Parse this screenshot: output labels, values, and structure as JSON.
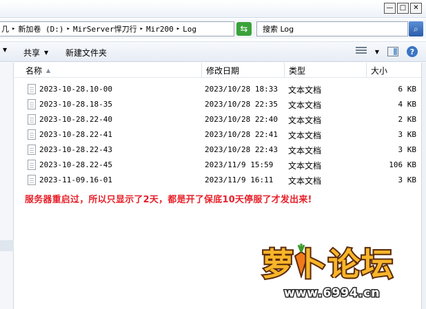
{
  "window": {
    "minimize_glyph": "—",
    "maximize_glyph": "□",
    "close_glyph": "✕"
  },
  "address": {
    "segments": [
      "几",
      "新加卷 (D:)",
      "MirServer悍刀行",
      "Mir200",
      "Log"
    ],
    "separator": "▸"
  },
  "search": {
    "placeholder": "搜索 Log"
  },
  "toolbar": {
    "share_label": "共享",
    "new_folder_label": "新建文件夹"
  },
  "columns": {
    "name": "名称",
    "modified": "修改日期",
    "type": "类型",
    "size": "大小"
  },
  "files": [
    {
      "name": "2023-10-28.10-00",
      "modified": "2023/10/28 18:33",
      "type": "文本文档",
      "size": "6 KB"
    },
    {
      "name": "2023-10-28.18-35",
      "modified": "2023/10/28 22:35",
      "type": "文本文档",
      "size": "4 KB"
    },
    {
      "name": "2023-10-28.22-40",
      "modified": "2023/10/28 22:40",
      "type": "文本文档",
      "size": "2 KB"
    },
    {
      "name": "2023-10-28.22-41",
      "modified": "2023/10/28 22:41",
      "type": "文本文档",
      "size": "3 KB"
    },
    {
      "name": "2023-10-28.22-43",
      "modified": "2023/10/28 22:43",
      "type": "文本文档",
      "size": "3 KB"
    },
    {
      "name": "2023-10-28.22-45",
      "modified": "2023/11/9 15:59",
      "type": "文本文档",
      "size": "106 KB"
    },
    {
      "name": "2023-11-09.16-01",
      "modified": "2023/11/9 16:11",
      "type": "文本文档",
      "size": "3 KB"
    }
  ],
  "annotation": "服务器重启过，所以只显示了2天，都是开了保底10天停服了才发出来!",
  "watermark": {
    "logo_text": "萝卜论坛",
    "url": "www.6994.cn"
  },
  "colors": {
    "annotation": "#e8202a",
    "refresh": "#3aa23a",
    "accent": "#3b75c4"
  }
}
